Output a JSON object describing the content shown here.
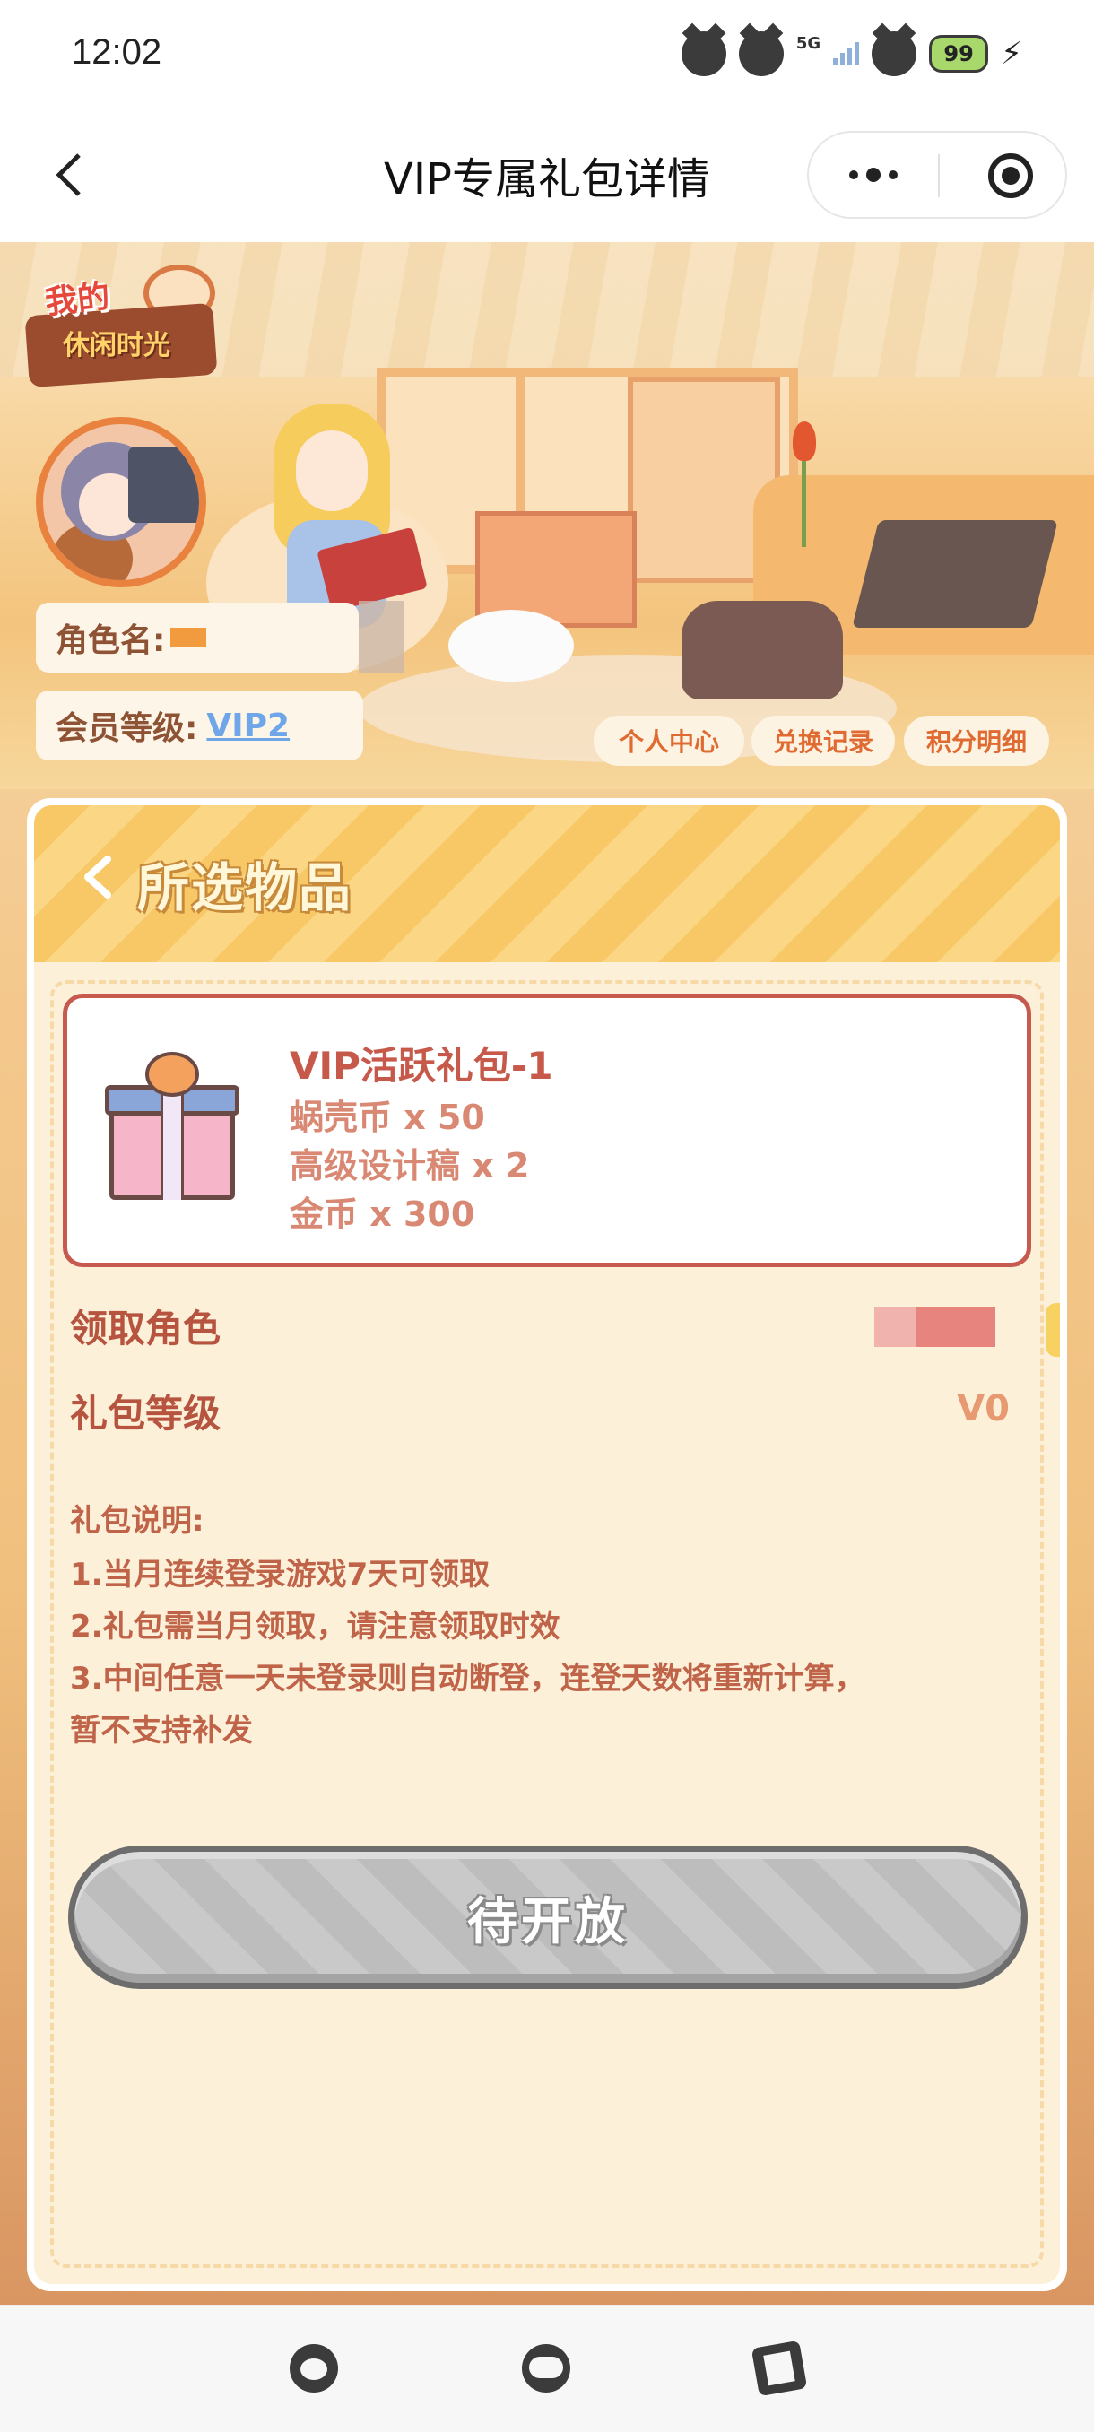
{
  "status_bar": {
    "time": "12:02",
    "network": "5G",
    "battery": "99",
    "icons": [
      "cat-icon",
      "cat-icon",
      "signal-icon",
      "wifi-icon",
      "battery-icon",
      "charging-icon"
    ]
  },
  "nav": {
    "title": "VIP专属礼包详情",
    "back_icon": "chevron-left-icon",
    "more_icon": "more-dots-icon",
    "close_icon": "target-close-icon"
  },
  "profile": {
    "logo_line1": "我的",
    "logo_line2": "休闲时光",
    "name_label": "角色名:",
    "level_label": "会员等级:",
    "level_value": "VIP2",
    "links": [
      "个人中心",
      "兑换记录",
      "积分明细"
    ]
  },
  "panel": {
    "title": "所选物品",
    "item": {
      "name": "VIP活跃礼包-1",
      "contents": [
        "蜗壳币 x 50",
        "高级设计稿 x 2",
        "金币 x 300"
      ]
    },
    "role_label": "领取角色",
    "level_label": "礼包等级",
    "level_value": "V0",
    "description": [
      "礼包说明:",
      "1.当月连续登录游戏7天可领取",
      "2.礼包需当月领取，请注意领取时效",
      "3.中间任意一天未登录则自动断登，连登天数将重新计算，",
      "暂不支持补发"
    ],
    "button_label": "待开放"
  },
  "colors": {
    "accent": "#c7594b",
    "header_stripe": "#f8c766",
    "button_disabled": "#bdbdbd",
    "link": "#6fa6e8"
  },
  "tab_bar": {
    "icons": [
      "paw-icon",
      "cat-face-icon",
      "notebook-icon"
    ]
  }
}
